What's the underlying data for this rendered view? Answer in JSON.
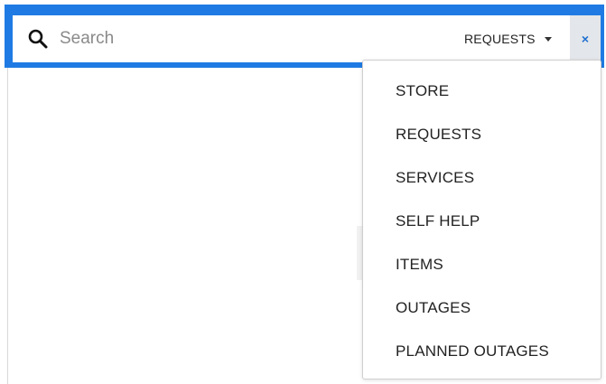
{
  "search": {
    "placeholder": "Search",
    "value": ""
  },
  "scope": {
    "selected": "REQUESTS",
    "options": [
      "STORE",
      "REQUESTS",
      "SERVICES",
      "SELF HELP",
      "ITEMS",
      "OUTAGES",
      "PLANNED OUTAGES"
    ]
  },
  "clear": {
    "label": "×"
  },
  "colors": {
    "accent": "#1f7be3",
    "clear_bg": "#e3e6ea",
    "clear_icon": "#1f6fd0"
  },
  "icons": {
    "search": "search-icon",
    "caret": "chevron-down-icon",
    "clear": "close-icon"
  }
}
